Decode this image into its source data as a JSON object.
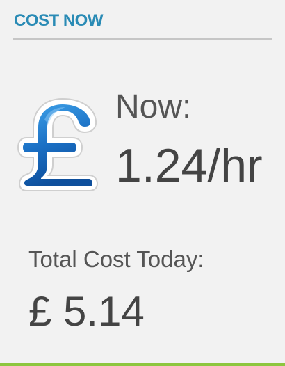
{
  "widget": {
    "header_title": "COST NOW",
    "now_label": "Now:",
    "now_rate": "1.24/hr",
    "total_label": "Total Cost Today:",
    "total_value": "£ 5.14",
    "icon": "pound-sterling-icon",
    "colors": {
      "header": "#2a8bb5",
      "icon_blue": "#1a6fc4",
      "text": "#444444",
      "accent_bar": "#8dc63f",
      "background": "#f2f2f2"
    }
  }
}
